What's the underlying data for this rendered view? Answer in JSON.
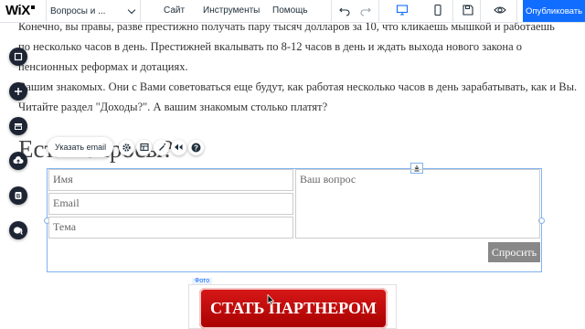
{
  "topbar": {
    "logo": "WiX",
    "page_name": "Вопросы и ...",
    "menu": [
      "Сайт",
      "Инструменты",
      "Помощь"
    ],
    "publish_label": "Опубликовать",
    "icons": [
      "undo-icon",
      "redo-icon",
      "desktop-icon",
      "mobile-icon",
      "save-icon",
      "preview-icon"
    ]
  },
  "content": {
    "lines": [
      "Конечно, вы правы, разве престижно получать пару тысяч долларов за 10, что кликаешь мышкой и работаешь",
      "по несколько часов в день. Престижней вкалывать по 8-12 часов в день и ждать выхода нового закона о",
      "пенсионных реформах и дотациях.",
      "Вашим знакомых. Они с Вами советоваться еще будут, как работая несколько часов в день зарабатывать, как  и Вы.",
      "Читайте раздел \"Доходы?\". А вашим знакомым столько платят?"
    ],
    "heading": "Есть вопросы?"
  },
  "rail": {
    "buttons": [
      "pages-icon",
      "add-icon",
      "background-icon",
      "upload-icon",
      "blog-icon",
      "chat-icon"
    ]
  },
  "toolbar": {
    "set_email": "Указать email",
    "icons": [
      "settings-icon",
      "layout-icon",
      "design-icon",
      "animation-icon",
      "help-icon"
    ]
  },
  "form": {
    "name_placeholder": "Имя",
    "email_placeholder": "Email",
    "subject_placeholder": "Тема",
    "question_placeholder": "Ваш вопрос",
    "submit_label": "Спросить"
  },
  "banner": {
    "tag": "Фото",
    "text": "СТАТЬ ПАРТНЕРОМ"
  },
  "colors": {
    "publish": "#116dff",
    "rail": "#1d2433",
    "banner": "#c80c0c",
    "selection": "#7fb2f0"
  }
}
